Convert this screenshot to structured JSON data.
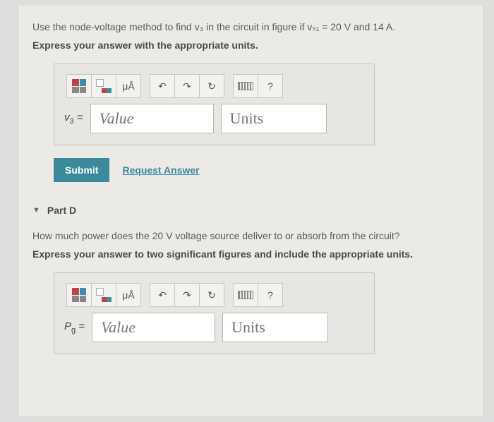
{
  "partC": {
    "question": "Use the node-voltage method to find v₃ in the circuit in figure if vₛ₁ = 20 V and 14 A.",
    "instruction": "Express your answer with the appropriate units.",
    "var_label_html": "v₃ =",
    "value_placeholder": "Value",
    "units_placeholder": "Units",
    "toolbar": {
      "units_btn": "μÅ",
      "undo": "↶",
      "redo": "↷",
      "reset": "↻",
      "help": "?"
    },
    "submit_label": "Submit",
    "request_label": "Request Answer"
  },
  "partD": {
    "header": "Part D",
    "question": "How much power does the 20 V voltage source deliver to or absorb from the circuit?",
    "instruction": "Express your answer to two significant figures and include the appropriate units.",
    "var_label_html": "Pg =",
    "value_placeholder": "Value",
    "units_placeholder": "Units",
    "toolbar": {
      "units_btn": "μÅ",
      "undo": "↶",
      "redo": "↷",
      "reset": "↻",
      "help": "?"
    }
  }
}
